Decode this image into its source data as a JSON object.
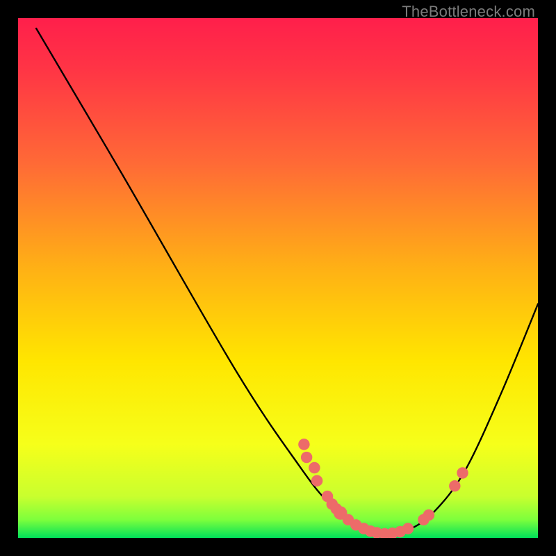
{
  "watermark": "TheBottleneck.com",
  "chart_data": {
    "type": "line",
    "title": "",
    "xlabel": "",
    "ylabel": "",
    "xlim": [
      0,
      100
    ],
    "ylim": [
      0,
      100
    ],
    "grid": false,
    "legend": "none",
    "colors": {
      "top": "#ff1f4b",
      "mid": "#ffe600",
      "bottom": "#00e05a",
      "curve": "#000000",
      "markers": "#ed6b69"
    },
    "curve": [
      {
        "x": 3.5,
        "y": 98.0
      },
      {
        "x": 20.0,
        "y": 70.0
      },
      {
        "x": 42.0,
        "y": 32.0
      },
      {
        "x": 54.0,
        "y": 14.0
      },
      {
        "x": 60.0,
        "y": 6.5
      },
      {
        "x": 66.0,
        "y": 2.0
      },
      {
        "x": 71.0,
        "y": 0.8
      },
      {
        "x": 75.0,
        "y": 1.5
      },
      {
        "x": 80.0,
        "y": 5.0
      },
      {
        "x": 86.0,
        "y": 13.0
      },
      {
        "x": 93.0,
        "y": 28.0
      },
      {
        "x": 100.0,
        "y": 45.0
      }
    ],
    "markers": [
      {
        "x": 55.0,
        "y": 18.0,
        "r": 1.1
      },
      {
        "x": 55.5,
        "y": 15.5,
        "r": 1.1
      },
      {
        "x": 57.0,
        "y": 13.5,
        "r": 1.1
      },
      {
        "x": 57.5,
        "y": 11.0,
        "r": 1.1
      },
      {
        "x": 59.5,
        "y": 8.0,
        "r": 1.1
      },
      {
        "x": 60.4,
        "y": 6.5,
        "r": 1.1
      },
      {
        "x": 61.2,
        "y": 5.6,
        "r": 1.1
      },
      {
        "x": 62.0,
        "y": 4.8,
        "r": 1.3
      },
      {
        "x": 63.5,
        "y": 3.5,
        "r": 1.1
      },
      {
        "x": 65.0,
        "y": 2.5,
        "r": 1.1
      },
      {
        "x": 66.5,
        "y": 1.8,
        "r": 1.1
      },
      {
        "x": 67.8,
        "y": 1.3,
        "r": 1.1
      },
      {
        "x": 69.0,
        "y": 1.0,
        "r": 1.1
      },
      {
        "x": 70.5,
        "y": 0.8,
        "r": 1.1
      },
      {
        "x": 72.0,
        "y": 0.9,
        "r": 1.1
      },
      {
        "x": 73.5,
        "y": 1.2,
        "r": 1.1
      },
      {
        "x": 75.0,
        "y": 1.8,
        "r": 1.1
      },
      {
        "x": 78.0,
        "y": 3.5,
        "r": 1.1
      },
      {
        "x": 79.0,
        "y": 4.4,
        "r": 1.1
      },
      {
        "x": 84.0,
        "y": 10.0,
        "r": 1.1
      },
      {
        "x": 85.5,
        "y": 12.5,
        "r": 1.1
      }
    ]
  }
}
